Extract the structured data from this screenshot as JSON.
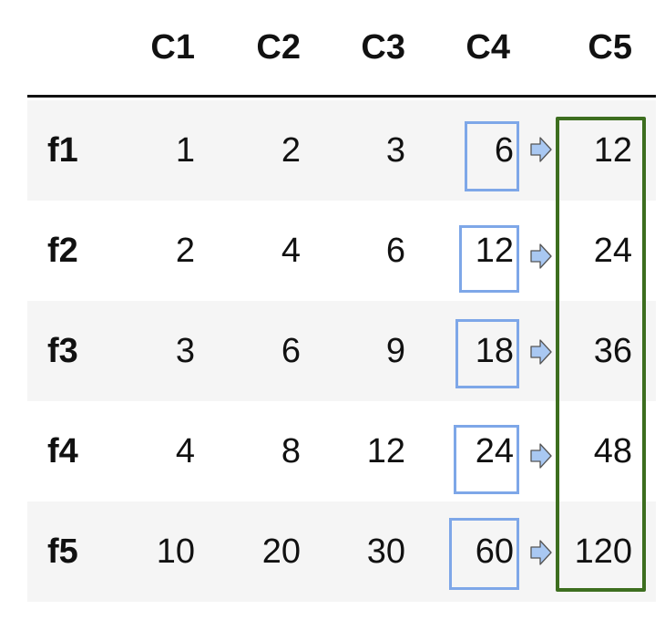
{
  "columns": [
    "C1",
    "C2",
    "C3",
    "C4",
    "C5"
  ],
  "rows": [
    {
      "label": "f1",
      "values": [
        "1",
        "2",
        "3",
        "6",
        "12"
      ]
    },
    {
      "label": "f2",
      "values": [
        "2",
        "4",
        "6",
        "12",
        "24"
      ]
    },
    {
      "label": "f3",
      "values": [
        "3",
        "6",
        "9",
        "18",
        "36"
      ]
    },
    {
      "label": "f4",
      "values": [
        "4",
        "8",
        "12",
        "24",
        "48"
      ]
    },
    {
      "label": "f5",
      "values": [
        "10",
        "20",
        "30",
        "60",
        "120"
      ]
    }
  ],
  "colors": {
    "row_stripe": "#f5f5f5",
    "c4_box": "#7ea7e8",
    "arrow_fill": "#a9c8f2",
    "c5_box": "#3d6e1f"
  },
  "icons": {
    "arrow": "arrow-right-icon"
  }
}
